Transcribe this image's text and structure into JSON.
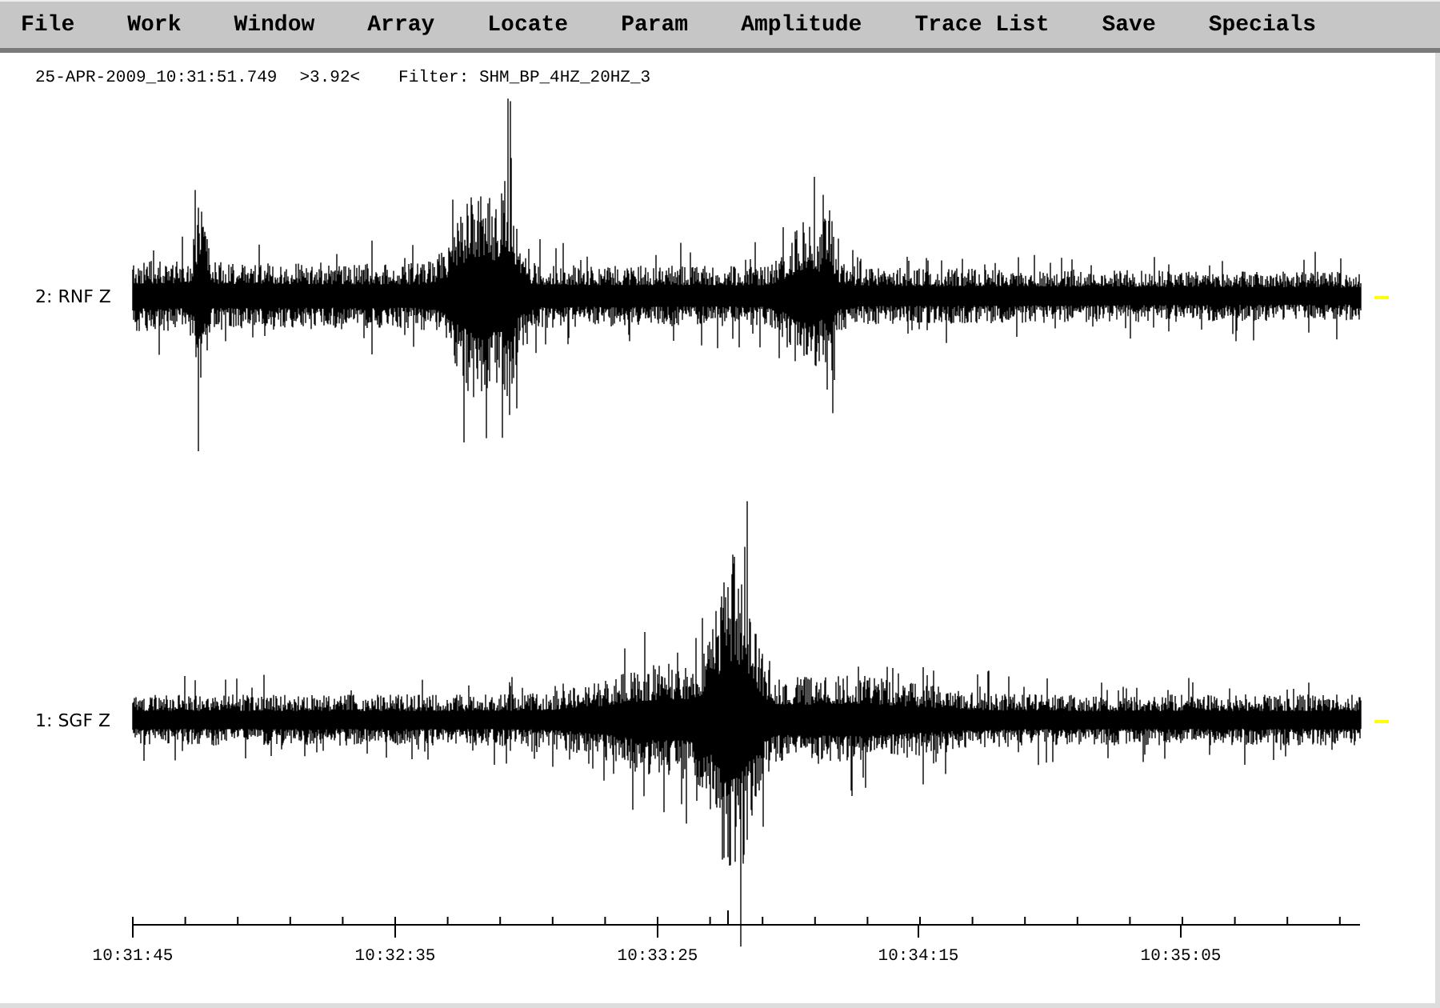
{
  "menu": [
    "File",
    "Work",
    "Window",
    "Array",
    "Locate",
    "Param",
    "Amplitude",
    "Trace List",
    "Save",
    "Specials"
  ],
  "header": {
    "timestamp": "25-APR-2009_10:31:51.749",
    "amplitude": ">3.92<",
    "filter": "Filter: SHM_BP_4HZ_20HZ_3"
  },
  "traces": [
    {
      "label": "2: RNF Z"
    },
    {
      "label": "1: SGF Z"
    }
  ],
  "time_axis": {
    "labels": [
      "10:31:45",
      "10:32:35",
      "10:33:25",
      "10:34:15",
      "10:35:05"
    ]
  }
}
